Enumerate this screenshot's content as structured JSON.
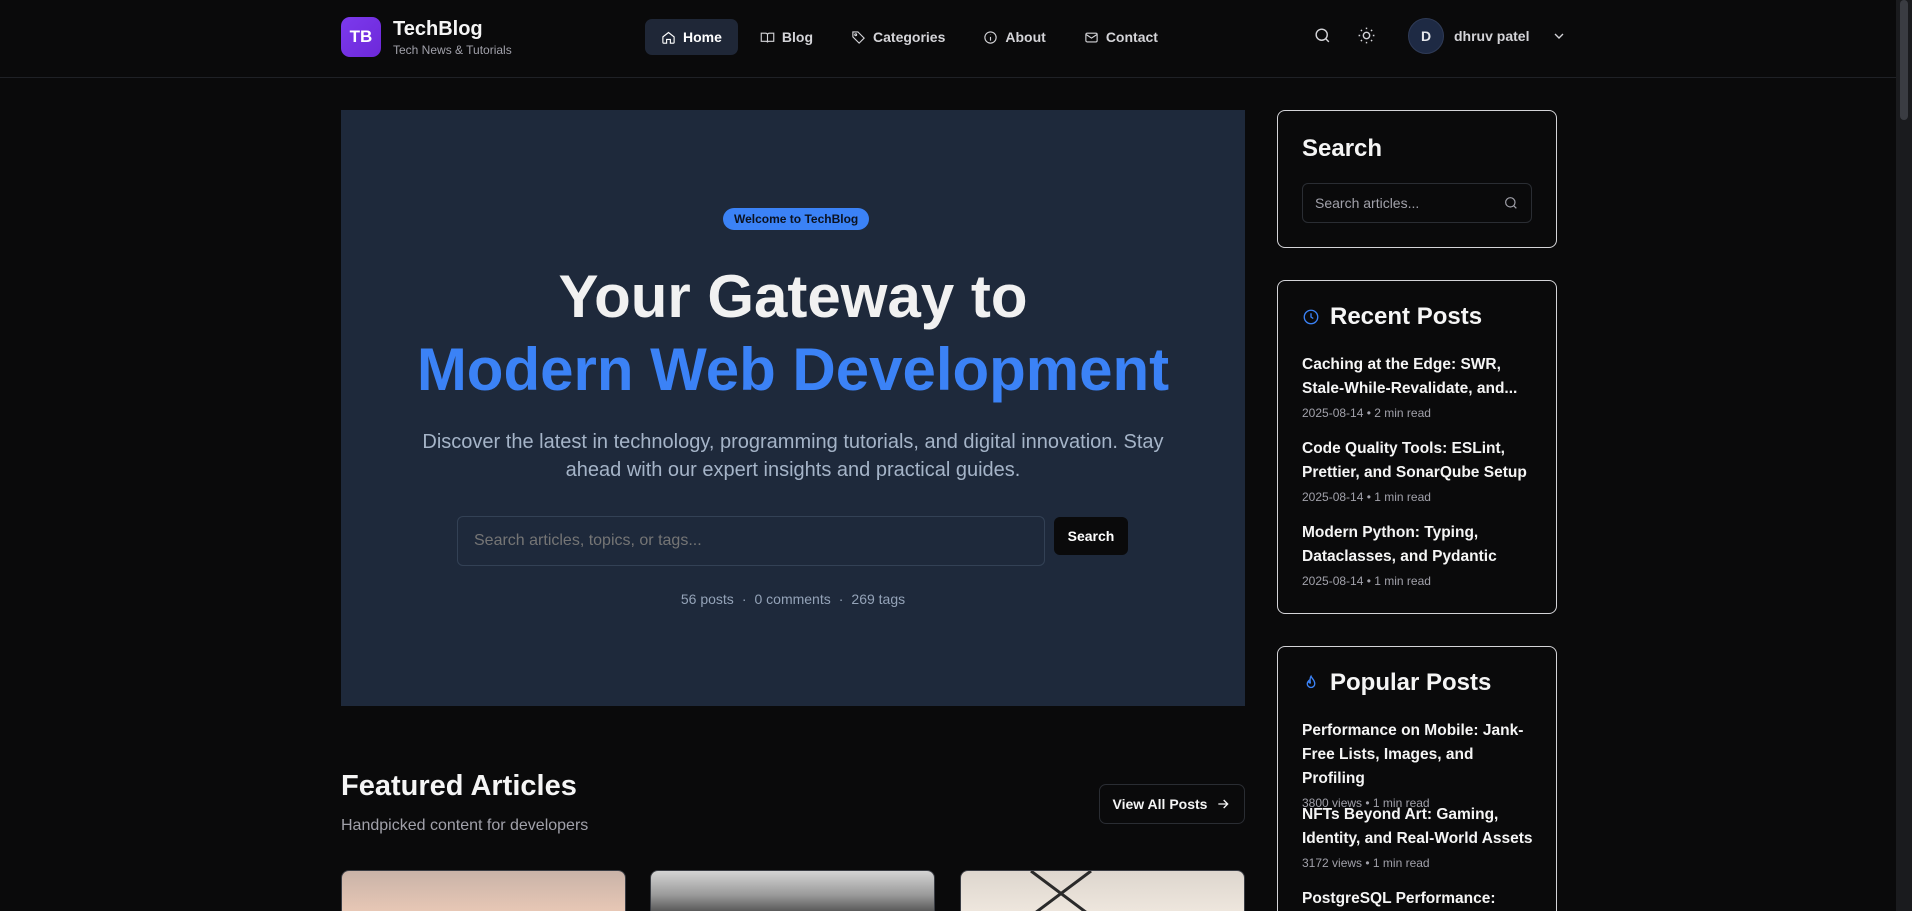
{
  "header": {
    "logo_text": "TB",
    "brand_name": "TechBlog",
    "brand_tagline": "Tech News & Tutorials",
    "nav": [
      {
        "label": "Home",
        "icon": "home-icon",
        "active": true
      },
      {
        "label": "Blog",
        "icon": "book-icon",
        "active": false
      },
      {
        "label": "Categories",
        "icon": "tag-icon",
        "active": false
      },
      {
        "label": "About",
        "icon": "info-icon",
        "active": false
      },
      {
        "label": "Contact",
        "icon": "mail-icon",
        "active": false
      }
    ],
    "user_initial": "D",
    "user_name": "dhruv patel"
  },
  "hero": {
    "badge": "Welcome to TechBlog",
    "title_line1": "Your Gateway to",
    "title_line2": "Modern Web Development",
    "subtitle": "Discover the latest in technology, programming tutorials, and digital innovation. Stay ahead with our expert insights and practical guides.",
    "search_placeholder": "Search articles, topics, or tags...",
    "search_button": "Search",
    "stats": {
      "posts": "56 posts",
      "comments": "0 comments",
      "tags": "269 tags",
      "separator": "·"
    }
  },
  "featured": {
    "title": "Featured Articles",
    "subtitle": "Handpicked content for developers",
    "view_all": "View All Posts"
  },
  "sidebar": {
    "search": {
      "title": "Search",
      "placeholder": "Search articles..."
    },
    "recent": {
      "title": "Recent Posts",
      "posts": [
        {
          "title": "Caching at the Edge: SWR, Stale-While-Revalidate, and...",
          "meta": "2025-08-14 • 2 min read"
        },
        {
          "title": "Code Quality Tools: ESLint, Prettier, and SonarQube Setup",
          "meta": "2025-08-14 • 1 min read"
        },
        {
          "title": "Modern Python: Typing, Dataclasses, and Pydantic",
          "meta": "2025-08-14 • 1 min read"
        }
      ]
    },
    "popular": {
      "title": "Popular Posts",
      "posts": [
        {
          "title": "Performance on Mobile: Jank-Free Lists, Images, and Profiling",
          "meta": "3800 views • 1 min read"
        },
        {
          "title": "NFTs Beyond Art: Gaming, Identity, and Real-World Assets",
          "meta": "3172 views • 1 min read"
        },
        {
          "title": "PostgreSQL Performance:",
          "meta": ""
        }
      ]
    }
  },
  "colors": {
    "accent": "#3b82f6",
    "background": "#0a0a0b",
    "hero_bg": "#1e293b",
    "logo": "#7c3aed"
  }
}
